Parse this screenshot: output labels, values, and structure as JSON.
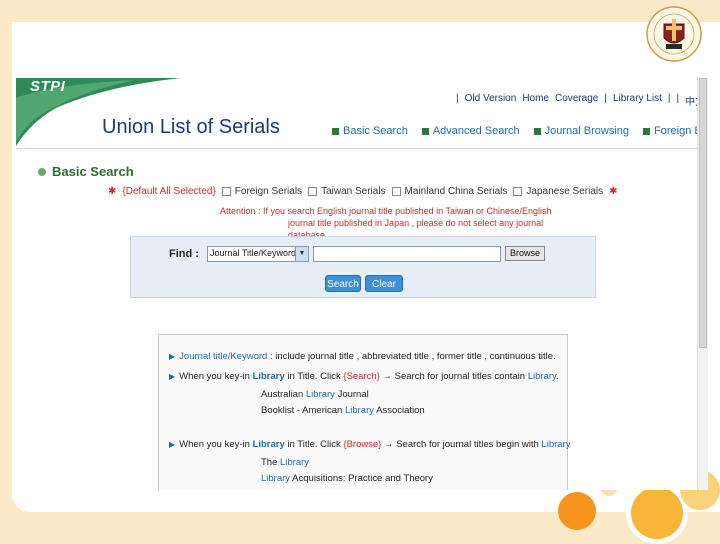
{
  "header": {
    "logo": "STPI",
    "title": "Union List of Serials",
    "top_links": [
      "Old Version",
      "Home",
      "Coverage",
      "Library List",
      "中文版"
    ],
    "nav_links": [
      "Basic Search",
      "Advanced Search",
      "Journal Browsing",
      "Foreign Books"
    ]
  },
  "basic_search": {
    "title": "Basic Search",
    "default_label": "{Default All Selected}",
    "filters": [
      "Foreign Serials",
      "Taiwan Serials",
      "Mainland China Serials",
      "Japanese Serials"
    ],
    "attention_line1": "Attention : If you search English journal title published in Taiwan or Chinese/English",
    "attention_line2": "journal title published in Japan , please do not select any journal database"
  },
  "search_form": {
    "find_label": "Find :",
    "field_select_value": "Journal Title/Keyword",
    "browse_label": "Browse",
    "search_label": "Search",
    "clear_label": "Clear"
  },
  "help": {
    "line1_term": "Journal title/Keyword",
    "line1_rest": " : include journal title , abbreviated title , former title , continuous title.",
    "line2_a": "When you key-in ",
    "line2_b": "Library",
    "line2_c": " in Title. Click ",
    "line2_d": "{Search}",
    "line2_e": " → Search for journal titles contain ",
    "line2_f": "Library",
    "line2_g": ".",
    "ex1_a": "Australian ",
    "ex1_b": "Library",
    "ex1_c": " Journal",
    "ex2_a": "Booklist - American ",
    "ex2_b": "Library",
    "ex2_c": " Association",
    "line3_a": "When you key-in ",
    "line3_b": "Library",
    "line3_c": " in Title. Click ",
    "line3_d": "{Browse}",
    "line3_e": " → Search for journal titles begin with ",
    "line3_f": "Library",
    "ex3_a": "The ",
    "ex3_b": "Library",
    "ex4_a": "Library",
    "ex4_b": " Acquisitions: Practice and Theory"
  },
  "colors": {
    "slide_bg": "#fbe9c8",
    "title_blue": "#1f3a78",
    "link_blue": "#1f6bb3",
    "accent_green": "#2f6e2f",
    "alert_red": "#cc2a2a",
    "button_blue": "#3d8fd6"
  }
}
